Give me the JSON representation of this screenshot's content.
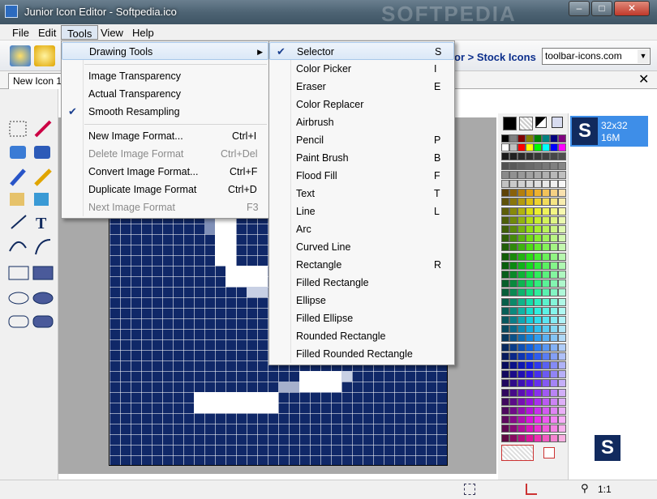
{
  "window": {
    "title": "Junior Icon Editor - Softpedia.ico",
    "watermark": "SOFTPEDIA",
    "min": "‒",
    "max": "□",
    "close": "✕"
  },
  "menubar": [
    "File",
    "Edit",
    "Tools",
    "View",
    "Help"
  ],
  "toolbar": {
    "stock_icons_prefix": "or",
    "stock_icons_label": "> Stock Icons",
    "source_combo": "toolbar-icons.com"
  },
  "document_tab": {
    "label": "New Icon 1",
    "close": "✕"
  },
  "tools_menu": {
    "drawing_tools": "Drawing Tools",
    "image_transparency": "Image Transparency",
    "actual_transparency": "Actual Transparency",
    "smooth_resampling": "Smooth Resampling",
    "new_image_format": {
      "label": "New Image Format...",
      "shortcut": "Ctrl+I"
    },
    "delete_image_format": {
      "label": "Delete Image Format",
      "shortcut": "Ctrl+Del"
    },
    "convert_image_format": {
      "label": "Convert Image Format...",
      "shortcut": "Ctrl+F"
    },
    "duplicate_image_format": {
      "label": "Duplicate Image Format",
      "shortcut": "Ctrl+D"
    },
    "next_image_format": {
      "label": "Next Image Format",
      "shortcut": "F3"
    }
  },
  "drawing_tools_menu": [
    {
      "label": "Selector",
      "shortcut": "S"
    },
    {
      "label": "Color Picker",
      "shortcut": "I"
    },
    {
      "label": "Eraser",
      "shortcut": "E"
    },
    {
      "label": "Color Replacer",
      "shortcut": ""
    },
    {
      "label": "Airbrush",
      "shortcut": ""
    },
    {
      "label": "Pencil",
      "shortcut": "P"
    },
    {
      "label": "Paint Brush",
      "shortcut": "B"
    },
    {
      "label": "Flood Fill",
      "shortcut": "F"
    },
    {
      "label": "Text",
      "shortcut": "T"
    },
    {
      "label": "Line",
      "shortcut": "L"
    },
    {
      "label": "Arc",
      "shortcut": ""
    },
    {
      "label": "Curved Line",
      "shortcut": ""
    },
    {
      "label": "Rectangle",
      "shortcut": "R"
    },
    {
      "label": "Filled Rectangle",
      "shortcut": ""
    },
    {
      "label": "Ellipse",
      "shortcut": ""
    },
    {
      "label": "Filled Ellipse",
      "shortcut": ""
    },
    {
      "label": "Rounded Rectangle",
      "shortcut": ""
    },
    {
      "label": "Filled Rounded Rectangle",
      "shortcut": ""
    }
  ],
  "image_formats": {
    "size": "32x32",
    "colors": "16M",
    "preview_letter": "S"
  },
  "statusbar": {
    "zoom": "1:1"
  },
  "palette_colors": [
    "#000000",
    "#808080",
    "#800000",
    "#808000",
    "#008000",
    "#008080",
    "#000080",
    "#800080",
    "#ffffff",
    "#c0c0c0",
    "#ff0000",
    "#ffff00",
    "#00ff00",
    "#00ffff",
    "#0000ff",
    "#ff00ff"
  ],
  "icons": {
    "app": "app-icon",
    "new": "new-icon-button",
    "open": "open-icon-button"
  }
}
